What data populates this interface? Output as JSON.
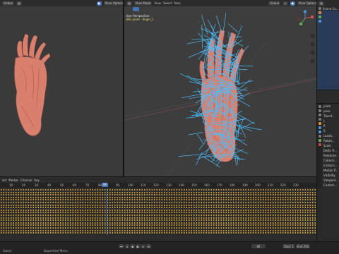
{
  "colors": {
    "accent": "#4772b3",
    "hair": "#4bbfff",
    "skin": "#d97f6e",
    "keyframe": "#d9a437",
    "playhead": "#4772b3"
  },
  "left_view": {
    "header": {
      "orientation_label": "Global",
      "overlay_label": "Pose Options"
    }
  },
  "main_view": {
    "header": {
      "mode_label": "Pose Mode",
      "menu_view": "View",
      "menu_select": "Select",
      "menu_pose": "Pose",
      "orientation_label": "Global",
      "overlay_label": "Pose Options"
    },
    "info_line1": "User Perspective",
    "info_line2": "(86) pinte · finger_1"
  },
  "right_panel": {
    "outliner_title": "Scene Co...",
    "properties_rows": [
      "pinte",
      "pose",
      "Transf...",
      "L",
      "R",
      "S",
      "Locati...",
      "Rotati...",
      "Scale",
      "Delta Tr...",
      "Relations",
      "Collecti...",
      "Instanci...",
      "Motion P...",
      "Visibility",
      "Viewport...",
      "Custom..."
    ]
  },
  "timeline": {
    "menus": [
      "ect",
      "Marker",
      "Channel",
      "Key"
    ],
    "ruler": [
      "10",
      "20",
      "30",
      "40",
      "50",
      "60",
      "70",
      "80",
      "90",
      "100",
      "110",
      "120",
      "130",
      "140",
      "150",
      "160",
      "170",
      "180",
      "190",
      "200",
      "210",
      "220",
      "230"
    ],
    "current_frame": "86",
    "footer_left": "Select",
    "footer_menu": "Dopesheet Menu",
    "frame_field": "86",
    "start_label": "Start",
    "start_value": "1",
    "end_label": "End",
    "end_value": "250"
  }
}
